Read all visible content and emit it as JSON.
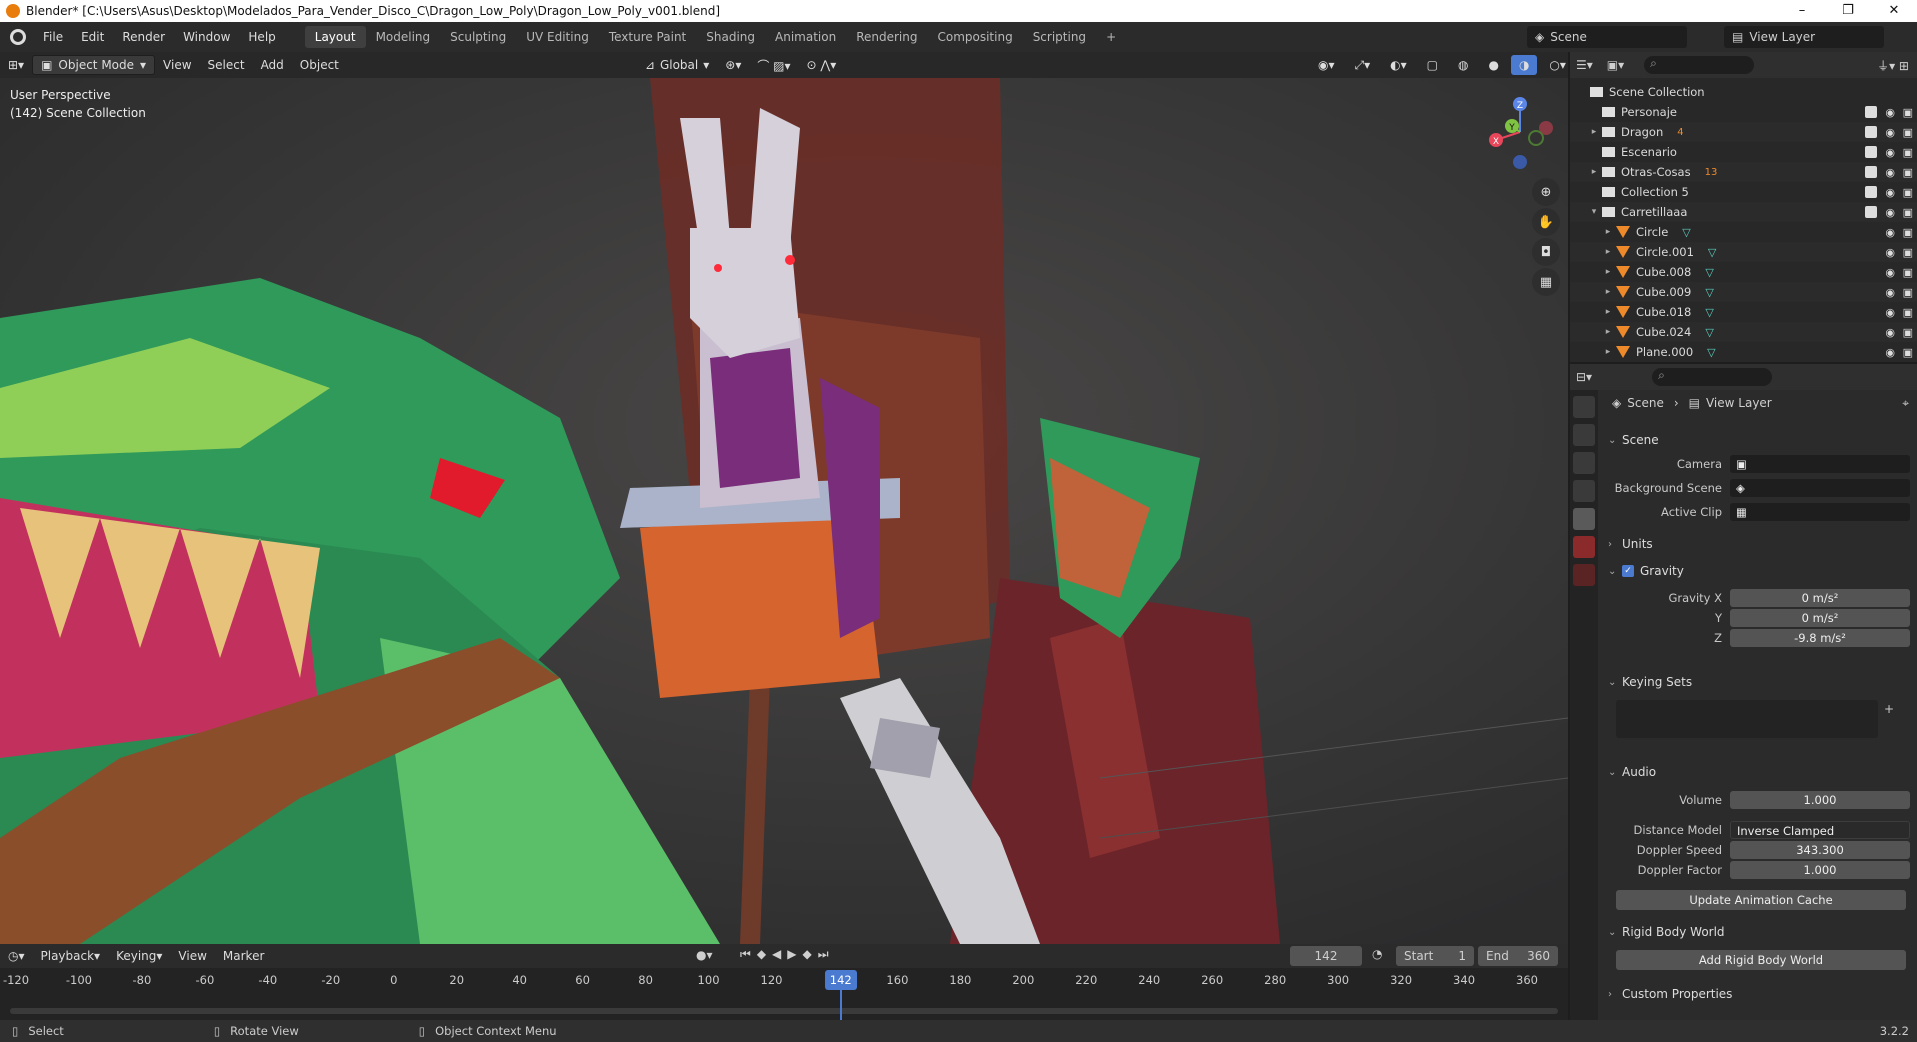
{
  "window": {
    "title": "Blender* [C:\\Users\\Asus\\Desktop\\Modelados_Para_Vender_Disco_C\\Dragon_Low_Poly\\Dragon_Low_Poly_v001.blend]",
    "minimize": "–",
    "restore": "❐",
    "close": "✕"
  },
  "menubar": {
    "menus": [
      "File",
      "Edit",
      "Render",
      "Window",
      "Help"
    ],
    "workspaces": [
      "Layout",
      "Modeling",
      "Sculpting",
      "UV Editing",
      "Texture Paint",
      "Shading",
      "Animation",
      "Rendering",
      "Compositing",
      "Scripting"
    ],
    "add_workspace": "+",
    "scene_label": "Scene",
    "view_layer_label": "View Layer"
  },
  "viewport_header": {
    "mode": "Object Mode",
    "menus": [
      "View",
      "Select",
      "Add",
      "Object"
    ],
    "transform_orientation": "Global"
  },
  "viewport": {
    "perspective": "User Perspective",
    "collection_info": "(142) Scene Collection",
    "gizmo_axes": [
      "X",
      "Y",
      "Z"
    ]
  },
  "outliner": {
    "root": "Scene Collection",
    "rows": [
      {
        "name": "Personaje",
        "type": "collection",
        "expand": "",
        "badge": ""
      },
      {
        "name": "Dragon",
        "type": "collection",
        "expand": "▸",
        "badge": "4"
      },
      {
        "name": "Escenario",
        "type": "collection",
        "expand": "",
        "badge": ""
      },
      {
        "name": "Otras-Cosas",
        "type": "collection",
        "expand": "▸",
        "badge": "13"
      },
      {
        "name": "Collection 5",
        "type": "collection",
        "expand": "",
        "badge": ""
      },
      {
        "name": "Carretillaaa",
        "type": "collection",
        "expand": "▾",
        "badge": ""
      },
      {
        "name": "Circle",
        "type": "object",
        "expand": "▸",
        "badge": ""
      },
      {
        "name": "Circle.001",
        "type": "object",
        "expand": "▸",
        "badge": ""
      },
      {
        "name": "Cube.008",
        "type": "object",
        "expand": "▸",
        "badge": ""
      },
      {
        "name": "Cube.009",
        "type": "object",
        "expand": "▸",
        "badge": ""
      },
      {
        "name": "Cube.018",
        "type": "object",
        "expand": "▸",
        "badge": ""
      },
      {
        "name": "Cube.024",
        "type": "object",
        "expand": "▸",
        "badge": ""
      },
      {
        "name": "Plane.000",
        "type": "object",
        "expand": "▸",
        "badge": ""
      }
    ]
  },
  "properties": {
    "breadcrumb_scene": "Scene",
    "breadcrumb_layer": "View Layer",
    "sections": {
      "scene": "Scene",
      "units": "Units",
      "gravity": "Gravity",
      "keying_sets": "Keying Sets",
      "audio": "Audio",
      "rigid_body": "Rigid Body World",
      "custom": "Custom Properties"
    },
    "camera_label": "Camera",
    "background_scene_label": "Background Scene",
    "active_clip_label": "Active Clip",
    "gravity_x_label": "Gravity X",
    "gravity_x": "0 m/s²",
    "gravity_y_label": "Y",
    "gravity_y": "0 m/s²",
    "gravity_z_label": "Z",
    "gravity_z": "-9.8 m/s²",
    "volume_label": "Volume",
    "volume": "1.000",
    "distance_model_label": "Distance Model",
    "distance_model": "Inverse Clamped",
    "doppler_speed_label": "Doppler Speed",
    "doppler_speed": "343.300",
    "doppler_factor_label": "Doppler Factor",
    "doppler_factor": "1.000",
    "update_cache_button": "Update Animation Cache",
    "add_rigid_body_button": "Add Rigid Body World"
  },
  "timeline": {
    "menus": [
      "Playback",
      "Keying",
      "View",
      "Marker"
    ],
    "current_frame": "142",
    "start_label": "Start",
    "start": "1",
    "end_label": "End",
    "end": "360",
    "ticks": [
      "-120",
      "-100",
      "-80",
      "-60",
      "-40",
      "-20",
      "0",
      "20",
      "40",
      "60",
      "80",
      "100",
      "120",
      "160",
      "180",
      "200",
      "220",
      "240",
      "260",
      "280",
      "300",
      "320",
      "340",
      "360"
    ],
    "playhead": "142"
  },
  "statusbar": {
    "select": "Select",
    "rotate": "Rotate View",
    "context": "Object Context Menu",
    "version": "3.2.2"
  }
}
